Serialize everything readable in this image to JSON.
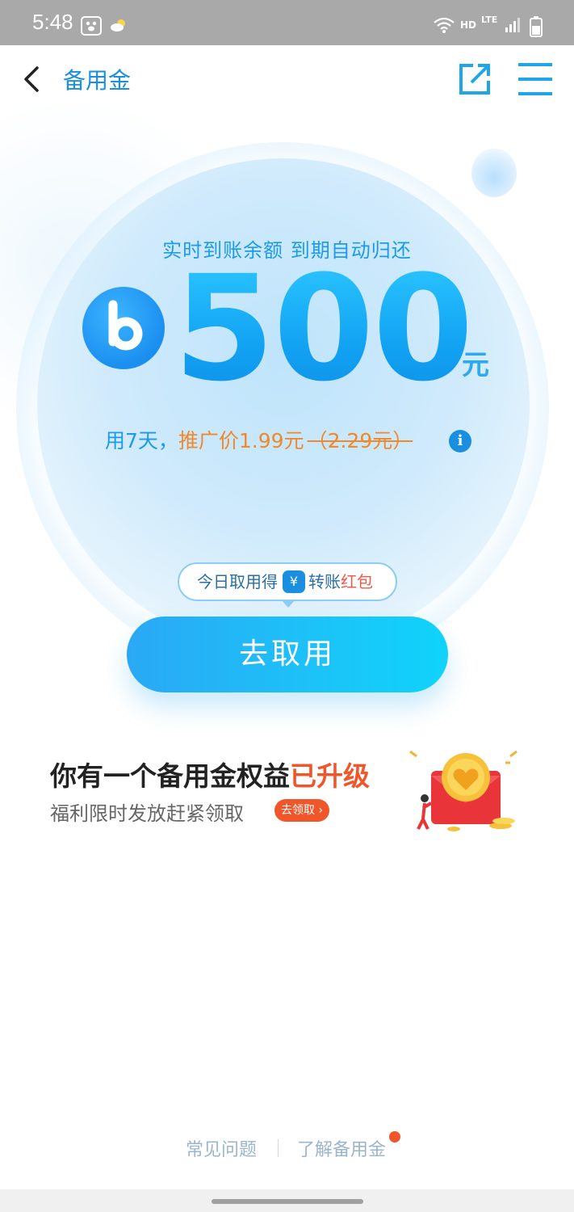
{
  "status_bar": {
    "time": "5:48",
    "icons": [
      "paw-notification-icon",
      "weather-icon",
      "wifi-icon",
      "hd-icon",
      "lte-signal-icon",
      "battery-icon"
    ],
    "hd_label": "HD",
    "lte_label": "LTE"
  },
  "header": {
    "title": "备用金",
    "back_icon": "back-chevron-icon",
    "share_icon": "share-external-icon",
    "menu_icon": "menu-icon",
    "accent_color": "#1a8fe0"
  },
  "hero": {
    "subtitle": "实时到账余额 到期自动归还",
    "amount": "500",
    "currency": "元",
    "price_days": "用7天，",
    "price_promo": "推广价1.99元",
    "price_original": "（2.29元）",
    "info_icon_label": "i"
  },
  "reward_pill": {
    "prefix": "今日取用得",
    "transfer_icon_label": "¥",
    "suffix_blue": "转账",
    "suffix_red": "红包"
  },
  "cta": {
    "label": "去取用"
  },
  "promo": {
    "title_main": "你有一个备用金权益",
    "title_highlight": "已升级",
    "subtitle": "福利限时发放赶紧领取",
    "badge": "去领取 ›"
  },
  "footer": {
    "faq": "常见问题",
    "learn": "了解备用金"
  }
}
